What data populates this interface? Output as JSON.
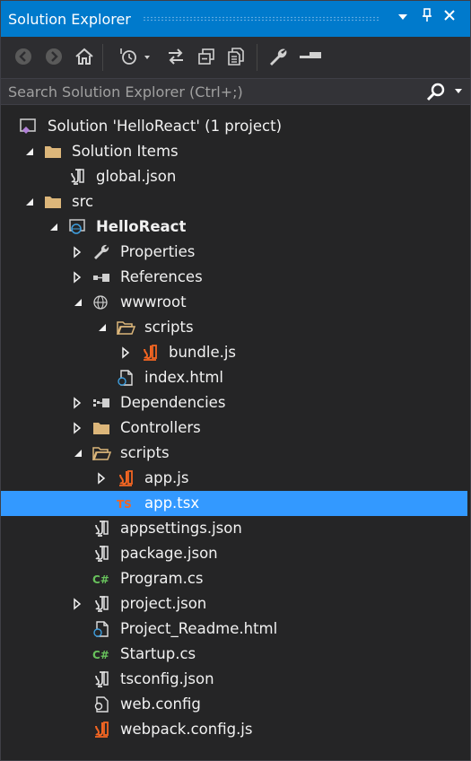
{
  "window": {
    "title": "Solution Explorer",
    "pin_icon": "pin-icon",
    "close_icon": "close-icon",
    "menu_icon": "dropdown-icon"
  },
  "toolbar": {
    "tools": [
      "back-icon",
      "forward-icon",
      "home-icon",
      "history-icon",
      "sync-icon",
      "collapse-all-icon",
      "show-all-files-icon",
      "properties-wrench-icon",
      "preview-icon"
    ]
  },
  "search": {
    "placeholder": "Search Solution Explorer (Ctrl+;)",
    "value": ""
  },
  "colors": {
    "accent": "#007acc",
    "selection": "#3399ff",
    "background": "#252526",
    "folder": "#dcb67a",
    "js_orange": "#f26522",
    "csharp_green": "#68c25c"
  },
  "tree": [
    {
      "label": "Solution 'HelloReact' (1 project)",
      "icon": "solution-icon",
      "expander": "none"
    },
    {
      "label": "Solution Items",
      "icon": "folder-icon",
      "expander": "expanded"
    },
    {
      "label": "global.json",
      "icon": "json-file-icon",
      "expander": "none"
    },
    {
      "label": "src",
      "icon": "folder-icon",
      "expander": "expanded"
    },
    {
      "label": "HelloReact",
      "icon": "web-project-icon",
      "expander": "expanded",
      "bold": true
    },
    {
      "label": "Properties",
      "icon": "wrench-icon",
      "expander": "collapsed"
    },
    {
      "label": "References",
      "icon": "references-icon",
      "expander": "collapsed"
    },
    {
      "label": "wwwroot",
      "icon": "globe-icon",
      "expander": "expanded"
    },
    {
      "label": "scripts",
      "icon": "folder-open-icon",
      "expander": "expanded"
    },
    {
      "label": "bundle.js",
      "icon": "js-file-icon",
      "expander": "collapsed"
    },
    {
      "label": "index.html",
      "icon": "html-file-icon",
      "expander": "none"
    },
    {
      "label": "Dependencies",
      "icon": "dependencies-icon",
      "expander": "collapsed"
    },
    {
      "label": "Controllers",
      "icon": "folder-icon",
      "expander": "collapsed"
    },
    {
      "label": "scripts",
      "icon": "folder-open-icon",
      "expander": "expanded"
    },
    {
      "label": "app.js",
      "icon": "js-file-icon",
      "expander": "collapsed"
    },
    {
      "label": "app.tsx",
      "icon": "ts-file-icon",
      "expander": "none",
      "selected": true
    },
    {
      "label": "appsettings.json",
      "icon": "json-file-icon",
      "expander": "none"
    },
    {
      "label": "package.json",
      "icon": "json-file-icon",
      "expander": "none"
    },
    {
      "label": "Program.cs",
      "icon": "csharp-file-icon",
      "expander": "none"
    },
    {
      "label": "project.json",
      "icon": "json-file-icon",
      "expander": "collapsed"
    },
    {
      "label": "Project_Readme.html",
      "icon": "html-file-icon",
      "expander": "none"
    },
    {
      "label": "Startup.cs",
      "icon": "csharp-file-icon",
      "expander": "none"
    },
    {
      "label": "tsconfig.json",
      "icon": "json-file-icon",
      "expander": "none"
    },
    {
      "label": "web.config",
      "icon": "config-file-icon",
      "expander": "none"
    },
    {
      "label": "webpack.config.js",
      "icon": "js-file-icon",
      "expander": "none"
    }
  ]
}
